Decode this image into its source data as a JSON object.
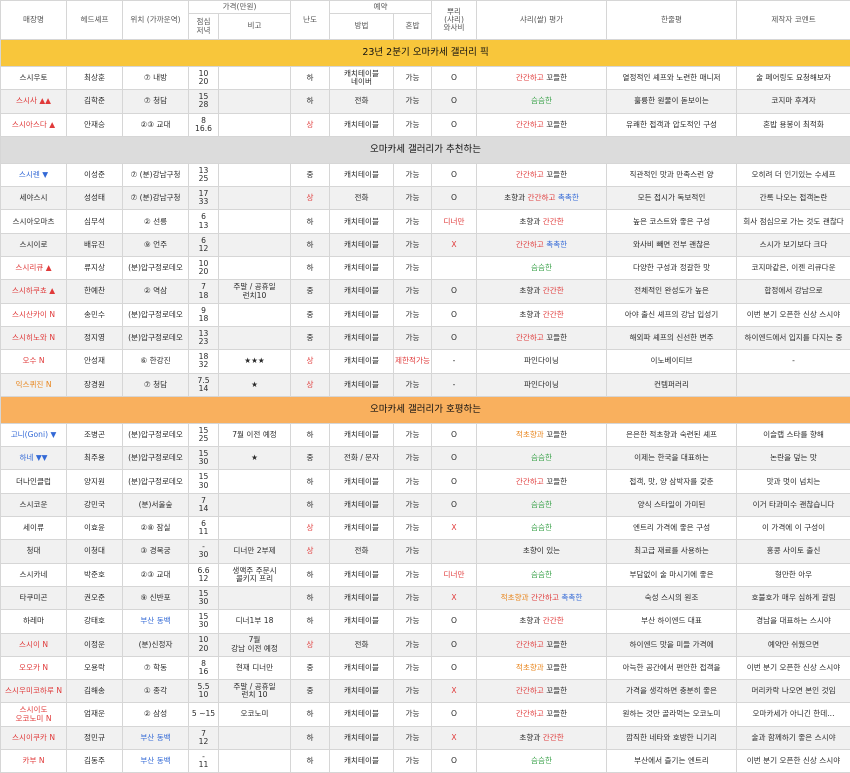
{
  "headers": {
    "name": "매장명",
    "chef": "헤드셰프",
    "location": "위치\n(가까운역)",
    "price": "가격(만원)",
    "price_lunch_dinner": "점심\n저녁",
    "price_note": "비고",
    "difficulty": "난도",
    "reservation": "예약",
    "method": "방법",
    "solo": "혼밥",
    "rice": "뿌리\n(샤리)\n와사비",
    "shari_eval": "샤리(쌀) 평가",
    "one_line": "한줄평",
    "comment": "제작자 코멘트"
  },
  "sections": [
    {
      "title": "23년 2분기 오마카세 갤러리 픽",
      "color": "#f8c63b",
      "rows": [
        {
          "name": "스시우토",
          "name_color": "",
          "chef": "최상훈",
          "loc": "⑦ 내방",
          "price": "10\n20",
          "note": "",
          "diff": "하",
          "diff_color": "",
          "method": "캐치테이블\n네이버",
          "solo": "가능",
          "solo_color": "",
          "wasabi": "O",
          "wasabi_color": "",
          "eval": [
            {
              "t": "간간하고",
              "c": "#e03a3a"
            },
            {
              "t": " 꼬들한",
              "c": ""
            }
          ],
          "review": "열정적인 셰프와 노련한 매니저",
          "comment": "술 페어링도 요청해보자"
        },
        {
          "name": "스시사 ▲▲",
          "name_color": "#e03a3a",
          "chef": "김학준",
          "loc": "⑦ 청담",
          "price": "15\n28",
          "note": "",
          "diff": "하",
          "diff_color": "",
          "method": "전화",
          "solo": "가능",
          "solo_color": "",
          "wasabi": "O",
          "wasabi_color": "",
          "eval": [
            {
              "t": "슴슴한",
              "c": "#3aa24a"
            }
          ],
          "review": "훌륭한 원물이 돋보이는",
          "comment": "코지마 후계자"
        },
        {
          "name": "스시아스다 ▲",
          "name_color": "#e03a3a",
          "chef": "안재승",
          "loc": "②③ 교대",
          "price": "8\n16.6",
          "note": "",
          "diff": "상",
          "diff_color": "#e03a3a",
          "method": "캐치테이블",
          "solo": "가능",
          "solo_color": "",
          "wasabi": "O",
          "wasabi_color": "",
          "eval": [
            {
              "t": "간간하고",
              "c": "#e03a3a"
            },
            {
              "t": " 꼬들한",
              "c": ""
            }
          ],
          "review": "유쾌한 접객과 압도적인 구성",
          "comment": "혼밥 용봉이 최적화"
        }
      ]
    },
    {
      "title": "오마카세 갤러리가 추천하는",
      "color": "#dcdcdc",
      "rows": [
        {
          "name": "스시렌 ▼",
          "name_color": "#3369d6",
          "chef": "이성준",
          "loc": "⑦ (분)강남구청",
          "price": "13\n25",
          "note": "",
          "diff": "중",
          "diff_color": "",
          "method": "캐치테이블",
          "solo": "가능",
          "solo_color": "",
          "wasabi": "O",
          "wasabi_color": "",
          "eval": [
            {
              "t": "간간하고",
              "c": "#e03a3a"
            },
            {
              "t": " 꼬들한",
              "c": ""
            }
          ],
          "review": "직관적인 맛과 만족스런 양",
          "comment": "오히려 더 인기있는 수세프"
        },
        {
          "name": "세야스시",
          "name_color": "",
          "chef": "성성태",
          "loc": "⑦ (분)강남구청",
          "price": "17\n33",
          "note": "",
          "diff": "상",
          "diff_color": "#e03a3a",
          "method": "전화",
          "solo": "가능",
          "solo_color": "",
          "wasabi": "O",
          "wasabi_color": "",
          "eval": [
            {
              "t": "초향과 ",
              "c": ""
            },
            {
              "t": "간간하고",
              "c": "#e03a3a"
            },
            {
              "t": " 촉촉한",
              "c": "#3369d6"
            }
          ],
          "review": "모든 접시가 독보적인",
          "comment": "간록 나오는 접객논란"
        },
        {
          "name": "스시아오마츠",
          "name_color": "",
          "chef": "심무석",
          "loc": "② 선릉",
          "price": "6\n13",
          "note": "",
          "diff": "하",
          "diff_color": "",
          "method": "캐치테이블",
          "solo": "가능",
          "solo_color": "",
          "wasabi": "디너만",
          "wasabi_color": "#e03a3a",
          "eval": [
            {
              "t": "초향과 ",
              "c": ""
            },
            {
              "t": "간간한",
              "c": "#e03a3a"
            }
          ],
          "review": "높은 코스트와 좋은 구성",
          "comment": "회사 점심으로 가는 것도 괜찮다"
        },
        {
          "name": "스시이로",
          "name_color": "",
          "chef": "배유진",
          "loc": "⑨ 언주",
          "price": "6\n12",
          "note": "",
          "diff": "하",
          "diff_color": "",
          "method": "캐치테이블",
          "solo": "가능",
          "solo_color": "",
          "wasabi": "X",
          "wasabi_color": "#e03a3a",
          "eval": [
            {
              "t": "간간하고",
              "c": "#e03a3a"
            },
            {
              "t": " 촉촉한",
              "c": "#3369d6"
            }
          ],
          "review": "와사비 빼면 전부 괜찮은",
          "comment": "스시가 보기보다 크다"
        },
        {
          "name": "스시리큐 ▲",
          "name_color": "#e03a3a",
          "chef": "류지상",
          "loc": "(분)압구정로데오",
          "price": "10\n20",
          "note": "",
          "diff": "하",
          "diff_color": "",
          "method": "캐치테이블",
          "solo": "가능",
          "solo_color": "",
          "wasabi": "",
          "wasabi_color": "",
          "eval": [
            {
              "t": "슴슴한",
              "c": "#3aa24a"
            }
          ],
          "review": "다양한 구성과 정갈한 맛",
          "comment": "코지마같은, 이젠 리큐다운"
        },
        {
          "name": "스시하쿠쵸 ▲",
          "name_color": "#e03a3a",
          "chef": "한예찬",
          "loc": "② 역삼",
          "price": "7\n18",
          "note": "주말 / 공휴일\n런치10",
          "diff": "중",
          "diff_color": "",
          "method": "캐치테이블",
          "solo": "가능",
          "solo_color": "",
          "wasabi": "O",
          "wasabi_color": "",
          "eval": [
            {
              "t": "초향과 ",
              "c": ""
            },
            {
              "t": "간간한",
              "c": "#e03a3a"
            }
          ],
          "review": "전체적인 완성도가 높은",
          "comment": "합정에서 강남으로"
        },
        {
          "name": "스시산카이 N",
          "name_color": "#e03a3a",
          "chef": "송민수",
          "loc": "(분)압구정로데오",
          "price": "9\n18",
          "note": "",
          "diff": "중",
          "diff_color": "",
          "method": "캐치테이블",
          "solo": "가능",
          "solo_color": "",
          "wasabi": "O",
          "wasabi_color": "",
          "eval": [
            {
              "t": "초향과 ",
              "c": ""
            },
            {
              "t": "간간한",
              "c": "#e03a3a"
            }
          ],
          "review": "아야 출신 셰프의 강남 입성기",
          "comment": "이번 분기 오픈한 신상 스시야"
        },
        {
          "name": "스시히노와 N",
          "name_color": "#e03a3a",
          "chef": "정지영",
          "loc": "(분)압구정로데오",
          "price": "13\n23",
          "note": "",
          "diff": "중",
          "diff_color": "",
          "method": "캐치테이블",
          "solo": "가능",
          "solo_color": "",
          "wasabi": "O",
          "wasabi_color": "",
          "eval": [
            {
              "t": "간간하고",
              "c": "#e03a3a"
            },
            {
              "t": " 꼬들한",
              "c": ""
            }
          ],
          "review": "해외파 셰프의 신선한 변주",
          "comment": "하이엔드에서 입지를 다지는 중"
        },
        {
          "name": "오수 N",
          "name_color": "#e03a3a",
          "chef": "안성재",
          "loc": "⑥ 한강진",
          "price": "18\n32",
          "note": "★★★",
          "diff": "상",
          "diff_color": "#e03a3a",
          "method": "캐치테이블",
          "solo": "제한적가능",
          "solo_color": "#e03a3a",
          "wasabi": "-",
          "wasabi_color": "",
          "eval": [
            {
              "t": "파인다이닝",
              "c": ""
            }
          ],
          "review": "이노베이티브",
          "comment": "-"
        },
        {
          "name": "익스퀴진 N",
          "name_color": "#e8851c",
          "chef": "장경원",
          "loc": "⑦ 청담",
          "price": "7.5\n14",
          "note": "★",
          "diff": "상",
          "diff_color": "#e03a3a",
          "method": "캐치테이블",
          "solo": "가능",
          "solo_color": "",
          "wasabi": "-",
          "wasabi_color": "",
          "eval": [
            {
              "t": "파인다이닝",
              "c": ""
            }
          ],
          "review": "컨템퍼러리",
          "comment": ""
        }
      ]
    },
    {
      "title": "오마카세 갤러리가 호평하는",
      "color": "#f9b05e",
      "rows": [
        {
          "name": "고니(Goni) ▼",
          "name_color": "#3369d6",
          "chef": "조병곤",
          "loc": "(분)압구정로데오",
          "price": "15\n25",
          "note": "7월 이전 예정",
          "diff": "하",
          "diff_color": "",
          "method": "캐치테이블",
          "solo": "가능",
          "solo_color": "",
          "wasabi": "O",
          "wasabi_color": "",
          "eval": [
            {
              "t": "적초향과",
              "c": "#e8851c"
            },
            {
              "t": " 꼬들한",
              "c": ""
            }
          ],
          "review": "은은한 적초향과 숙련된 셰프",
          "comment": "이슬랩 스타를 향해"
        },
        {
          "name": "하네 ▼▼",
          "name_color": "#3369d6",
          "chef": "최주용",
          "loc": "(분)압구정로데오",
          "price": "15\n30",
          "note": "★",
          "diff": "중",
          "diff_color": "",
          "method": "전화 / 문자",
          "solo": "가능",
          "solo_color": "",
          "wasabi": "O",
          "wasabi_color": "",
          "eval": [
            {
              "t": "슴슴한",
              "c": "#3aa24a"
            }
          ],
          "review": "이제는 한국을 대표하는",
          "comment": "논란을 덮는 맛"
        },
        {
          "name": "더나인클럽",
          "name_color": "",
          "chef": "양지원",
          "loc": "(분)압구정로데오",
          "price": "15\n30",
          "note": "",
          "diff": "하",
          "diff_color": "",
          "method": "캐치테이블",
          "solo": "가능",
          "solo_color": "",
          "wasabi": "O",
          "wasabi_color": "",
          "eval": [
            {
              "t": "간간하고",
              "c": "#e03a3a"
            },
            {
              "t": " 꼬들한",
              "c": ""
            }
          ],
          "review": "접객, 맛, 양 삼박자를 갖춘",
          "comment": "맛과 멋이 넘치는"
        },
        {
          "name": "스시코운",
          "name_color": "",
          "chef": "강민국",
          "loc": "(분)서울숲",
          "price": "7\n14",
          "note": "",
          "diff": "하",
          "diff_color": "",
          "method": "캐치테이블",
          "solo": "가능",
          "solo_color": "",
          "wasabi": "O",
          "wasabi_color": "",
          "eval": [
            {
              "t": "슴슴한",
              "c": "#3aa24a"
            }
          ],
          "review": "양식 스타일이 가미된",
          "comment": "이거 타과미수 괜찮습니다"
        },
        {
          "name": "세이류",
          "name_color": "",
          "chef": "이효윤",
          "loc": "②⑧ 잠실",
          "price": "6\n11",
          "note": "",
          "diff": "상",
          "diff_color": "#e03a3a",
          "method": "캐치테이블",
          "solo": "가능",
          "solo_color": "",
          "wasabi": "X",
          "wasabi_color": "#e03a3a",
          "eval": [
            {
              "t": "슴슴한",
              "c": "#3aa24a"
            }
          ],
          "review": "엔트리 가격에 좋은 구성",
          "comment": "이 가격에 이 구성이"
        },
        {
          "name": "청대",
          "name_color": "",
          "chef": "이청대",
          "loc": "③ 경복궁",
          "price": "-\n30",
          "note": "디너만 2부제",
          "diff": "상",
          "diff_color": "#e03a3a",
          "method": "전화",
          "solo": "가능",
          "solo_color": "",
          "wasabi": "",
          "wasabi_color": "",
          "eval": [
            {
              "t": "초향이 있는",
              "c": ""
            }
          ],
          "review": "최고급 재료를 사용하는",
          "comment": "홍콩 사이토 출신"
        },
        {
          "name": "스시카네",
          "name_color": "",
          "chef": "박준호",
          "loc": "②③ 교대",
          "price": "6.6\n12",
          "note": "생맥주 주문시\n콜키지 프리",
          "diff": "하",
          "diff_color": "",
          "method": "캐치테이블",
          "solo": "가능",
          "solo_color": "",
          "wasabi": "디너만",
          "wasabi_color": "#e03a3a",
          "eval": [
            {
              "t": "슴슴한",
              "c": "#3aa24a"
            }
          ],
          "review": "부담없이 술 마시기에 좋은",
          "comment": "형만한 아우"
        },
        {
          "name": "타쿠미곤",
          "name_color": "",
          "chef": "권오준",
          "loc": "⑨ 신반포",
          "price": "15\n30",
          "note": "",
          "diff": "하",
          "diff_color": "",
          "method": "캐치테이블",
          "solo": "가능",
          "solo_color": "",
          "wasabi": "X",
          "wasabi_color": "#e03a3a",
          "eval": [
            {
              "t": "적초향과",
              "c": "#e8851c"
            },
            {
              "t": " 간간하고",
              "c": "#e03a3a"
            },
            {
              "t": " 촉촉한",
              "c": "#3369d6"
            }
          ],
          "review": "숙성 스시의 원조",
          "comment": "호불호가 매우 심하게 갈림"
        },
        {
          "name": "하레마",
          "name_color": "",
          "chef": "강태호",
          "loc": "부산 동백",
          "loc_color": "#3369d6",
          "price": "15\n30",
          "note": "디너1부 18",
          "diff": "하",
          "diff_color": "",
          "method": "캐치테이블",
          "solo": "가능",
          "solo_color": "",
          "wasabi": "O",
          "wasabi_color": "",
          "eval": [
            {
              "t": "초향과 ",
              "c": ""
            },
            {
              "t": "간간한",
              "c": "#e03a3a"
            }
          ],
          "review": "부산 하이엔드 대표",
          "comment": "경남을 대표하는 스시야"
        },
        {
          "name": "스시이 N",
          "name_color": "#e03a3a",
          "chef": "이정운",
          "loc": "(분)신정자",
          "price": "10\n20",
          "note": "7월\n강남 이전 예정",
          "diff": "상",
          "diff_color": "#e03a3a",
          "method": "전화",
          "solo": "가능",
          "solo_color": "",
          "wasabi": "O",
          "wasabi_color": "",
          "eval": [
            {
              "t": "간간하고",
              "c": "#e03a3a"
            },
            {
              "t": " 꼬들한",
              "c": ""
            }
          ],
          "review": "하이엔드 맛을 미들 가격에",
          "comment": "예약만 쉬웠으면"
        },
        {
          "name": "오오카 N",
          "name_color": "#e03a3a",
          "chef": "오용락",
          "loc": "⑦ 학동",
          "price": "8\n16",
          "note": "현재 디너만",
          "diff": "중",
          "diff_color": "",
          "method": "캐치테이블",
          "solo": "가능",
          "solo_color": "",
          "wasabi": "O",
          "wasabi_color": "",
          "eval": [
            {
              "t": "적초향과",
              "c": "#e8851c"
            },
            {
              "t": " 꼬들한",
              "c": ""
            }
          ],
          "review": "아늑한 공간에서 편안한 접객을",
          "comment": "이번 분기 오픈한 신상 스시야"
        },
        {
          "name": "스시우미코하루 N",
          "name_color": "#e03a3a",
          "chef": "김해송",
          "loc": "① 종각",
          "price": "5.5\n10",
          "note": "주말 / 공휴일\n런치 10",
          "diff": "중",
          "diff_color": "",
          "method": "캐치테이블",
          "solo": "가능",
          "solo_color": "",
          "wasabi": "X",
          "wasabi_color": "#e03a3a",
          "eval": [
            {
              "t": "간간하고",
              "c": "#e03a3a"
            },
            {
              "t": " 꼬들한",
              "c": ""
            }
          ],
          "review": "가격을 생각하면 충분히 좋은",
          "comment": "머리카락 나오면 본인 것임"
        },
        {
          "name": "스시이도\n오코노미 N",
          "name_color": "#e03a3a",
          "chef": "엄재운",
          "loc": "② 삼성",
          "price": "5 ~15",
          "note": "오코노미",
          "diff": "하",
          "diff_color": "",
          "method": "캐치테이블",
          "solo": "가능",
          "solo_color": "",
          "wasabi": "O",
          "wasabi_color": "",
          "eval": [
            {
              "t": "간간하고",
              "c": "#e03a3a"
            },
            {
              "t": " 꼬들한",
              "c": ""
            }
          ],
          "review": "원하는 것만 골라먹는 오코노미",
          "comment": "오마카세가 아니긴 한데..."
        },
        {
          "name": "스시이쿠카 N",
          "name_color": "#e03a3a",
          "chef": "정민규",
          "loc": "부산 동백",
          "loc_color": "#3369d6",
          "price": "7\n12",
          "note": "",
          "diff": "하",
          "diff_color": "",
          "method": "캐치테이블",
          "solo": "가능",
          "solo_color": "",
          "wasabi": "X",
          "wasabi_color": "#e03a3a",
          "eval": [
            {
              "t": "초향과 ",
              "c": ""
            },
            {
              "t": "간간한",
              "c": "#e03a3a"
            }
          ],
          "review": "깜직한 네타와 호방한 니기리",
          "comment": "술과 함께하기 좋은 스시야"
        },
        {
          "name": "카부 N",
          "name_color": "#e03a3a",
          "chef": "김동주",
          "loc": "부산 동백",
          "loc_color": "#3369d6",
          "price": "-\n11",
          "note": "",
          "diff": "하",
          "diff_color": "",
          "method": "캐치테이블",
          "solo": "가능",
          "solo_color": "",
          "wasabi": "O",
          "wasabi_color": "",
          "eval": [
            {
              "t": "슴슴한",
              "c": "#3aa24a"
            }
          ],
          "review": "부산에서 즐기는 엔트리",
          "comment": "이번 분기 오픈한 신상 스시야"
        }
      ]
    }
  ]
}
